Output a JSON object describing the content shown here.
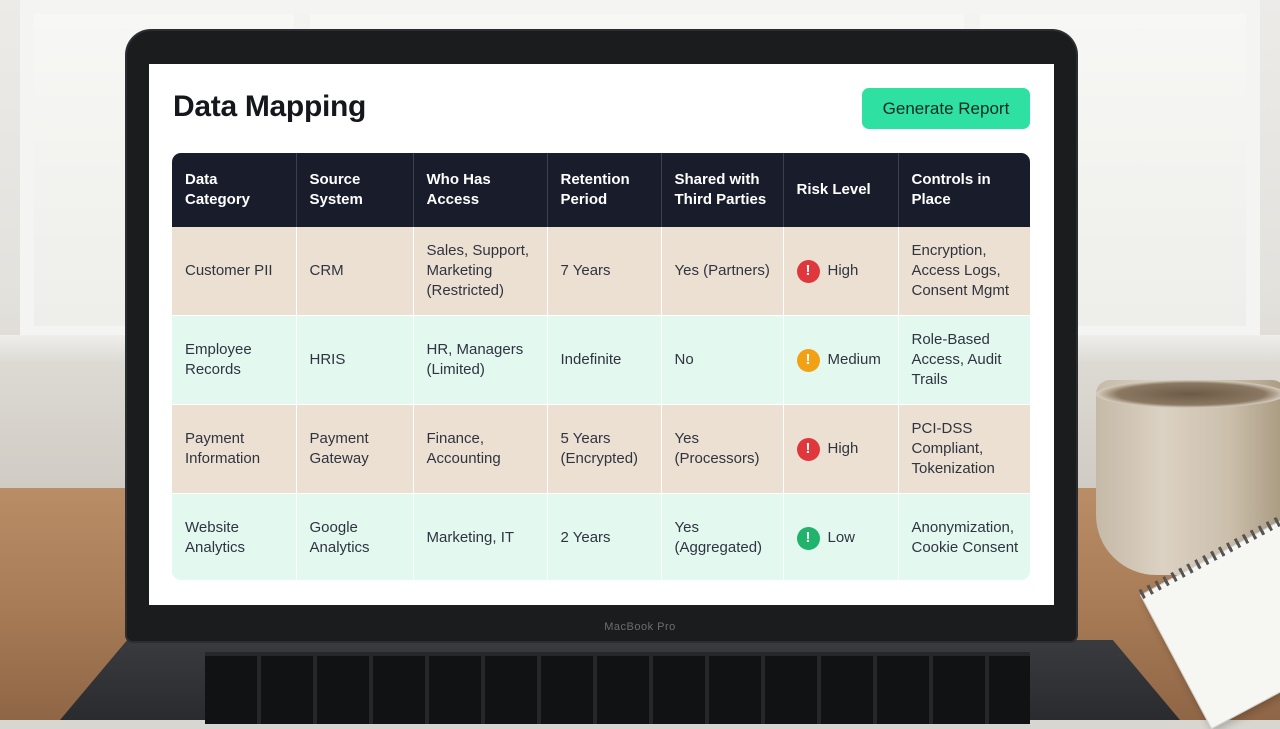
{
  "page": {
    "title": "Data Mapping",
    "generate_label": "Generate Report",
    "device_brand": "MacBook Pro"
  },
  "colors": {
    "accent": "#2fe0a3",
    "header_bg": "#181c2b",
    "row_tan": "#ece0d2",
    "row_mint": "#e3f8ef",
    "risk_high": "#e0373c",
    "risk_medium": "#f2a114",
    "risk_low": "#1fb36b"
  },
  "table": {
    "columns": [
      "Data Category",
      "Source System",
      "Who Has Access",
      "Retention Period",
      "Shared with Third Parties",
      "Risk Level",
      "Controls in Place"
    ],
    "rows": [
      {
        "category": "Customer PII",
        "source": "CRM",
        "access": "Sales, Support, Marketing (Restricted)",
        "retention": "7 Years",
        "shared": "Yes (Partners)",
        "risk": "High",
        "risk_icon": "exclamation-icon",
        "risk_color": "#e0373c",
        "controls": "Encryption, Access Logs, Consent Mgmt"
      },
      {
        "category": "Employee Records",
        "source": "HRIS",
        "access": "HR, Managers (Limited)",
        "retention": "Indefinite",
        "shared": "No",
        "risk": "Medium",
        "risk_icon": "exclamation-icon",
        "risk_color": "#f2a114",
        "controls": "Role-Based Access, Audit Trails"
      },
      {
        "category": "Payment Information",
        "source": "Payment Gateway",
        "access": "Finance, Accounting",
        "retention": "5 Years (Encrypted)",
        "shared": "Yes (Processors)",
        "risk": "High",
        "risk_icon": "exclamation-icon",
        "risk_color": "#e0373c",
        "controls": "PCI-DSS Compliant, Tokenization"
      },
      {
        "category": "Website Analytics",
        "source": "Google Analytics",
        "access": "Marketing, IT",
        "retention": "2 Years",
        "shared": "Yes (Aggregated)",
        "risk": "Low",
        "risk_icon": "exclamation-icon",
        "risk_color": "#1fb36b",
        "controls": "Anonymization, Cookie Consent"
      }
    ]
  }
}
